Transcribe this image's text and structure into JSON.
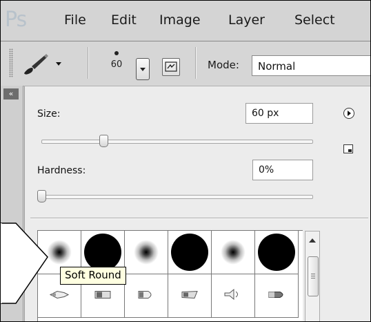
{
  "app": {
    "logo": "Ps"
  },
  "menu": {
    "items": [
      "File",
      "Edit",
      "Image",
      "Layer",
      "Select"
    ]
  },
  "options_bar": {
    "brush_size_value": "60",
    "mode_label": "Mode:",
    "mode_value": "Normal"
  },
  "brush_picker": {
    "size_label": "Size:",
    "size_value": "60 px",
    "size_slider_fraction": 0.23,
    "hardness_label": "Hardness:",
    "hardness_value": "0%",
    "hardness_slider_fraction": 0.0,
    "presets_row1": [
      "soft-round",
      "hard-round",
      "soft-round",
      "hard-round",
      "soft-round",
      "hard-round"
    ],
    "presets_row2": [
      "brush-tip-a",
      "brush-tip-b",
      "brush-tip-c",
      "brush-tip-d",
      "brush-tip-e",
      "brush-tip-f"
    ],
    "tooltip": "Soft Round"
  },
  "icons": {
    "brush": "paintbrush-icon",
    "dropdown": "chevron-down-icon",
    "panel_toggle": "brush-panel-icon",
    "picker_menu": "circle-arrow-icon",
    "new_preset": "new-preset-icon",
    "scroll_up": "arrow-up-icon"
  }
}
